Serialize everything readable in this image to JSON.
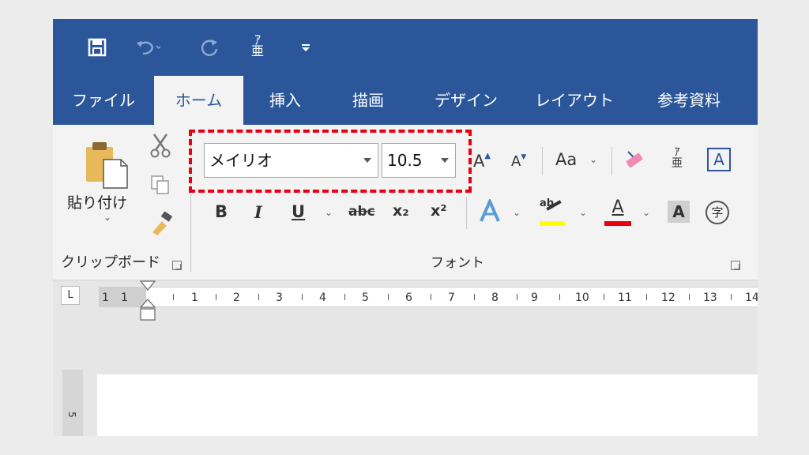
{
  "quick_access": {
    "save_icon": "save-icon",
    "undo_icon": "undo-icon",
    "redo_icon": "redo-icon",
    "phonetic_icon": "phonetic-guide-icon",
    "customize_icon": "customize-qat-icon"
  },
  "tabs": [
    {
      "label": "ファイル",
      "active": false
    },
    {
      "label": "ホーム",
      "active": true
    },
    {
      "label": "挿入",
      "active": false
    },
    {
      "label": "描画",
      "active": false
    },
    {
      "label": "デザイン",
      "active": false
    },
    {
      "label": "レイアウト",
      "active": false
    },
    {
      "label": "参考資料",
      "active": false
    }
  ],
  "clipboard": {
    "paste_label": "貼り付け",
    "group_label": "クリップボード"
  },
  "font": {
    "font_name": "メイリオ",
    "font_size": "10.5",
    "group_label": "フォント",
    "bold": "B",
    "italic": "I",
    "underline": "U",
    "strikethrough": "abc",
    "subscript": "x₂",
    "superscript": "x²",
    "change_case": "Aa",
    "highlight_color": "#ffff00",
    "font_color": "#e60012",
    "char_shading": "A",
    "enclosed_char": "字",
    "char_border": "A",
    "phonetic": "亜"
  },
  "ruler": {
    "tab_selector": "L",
    "marks": [
      "1",
      "1",
      "1",
      "2",
      "3",
      "4",
      "5",
      "6",
      "7",
      "8",
      "9",
      "10",
      "11",
      "12",
      "13",
      "14"
    ],
    "vertical_mark": "5"
  },
  "colors": {
    "title_bar": "#2b579a",
    "highlight_box": "#e60012"
  }
}
